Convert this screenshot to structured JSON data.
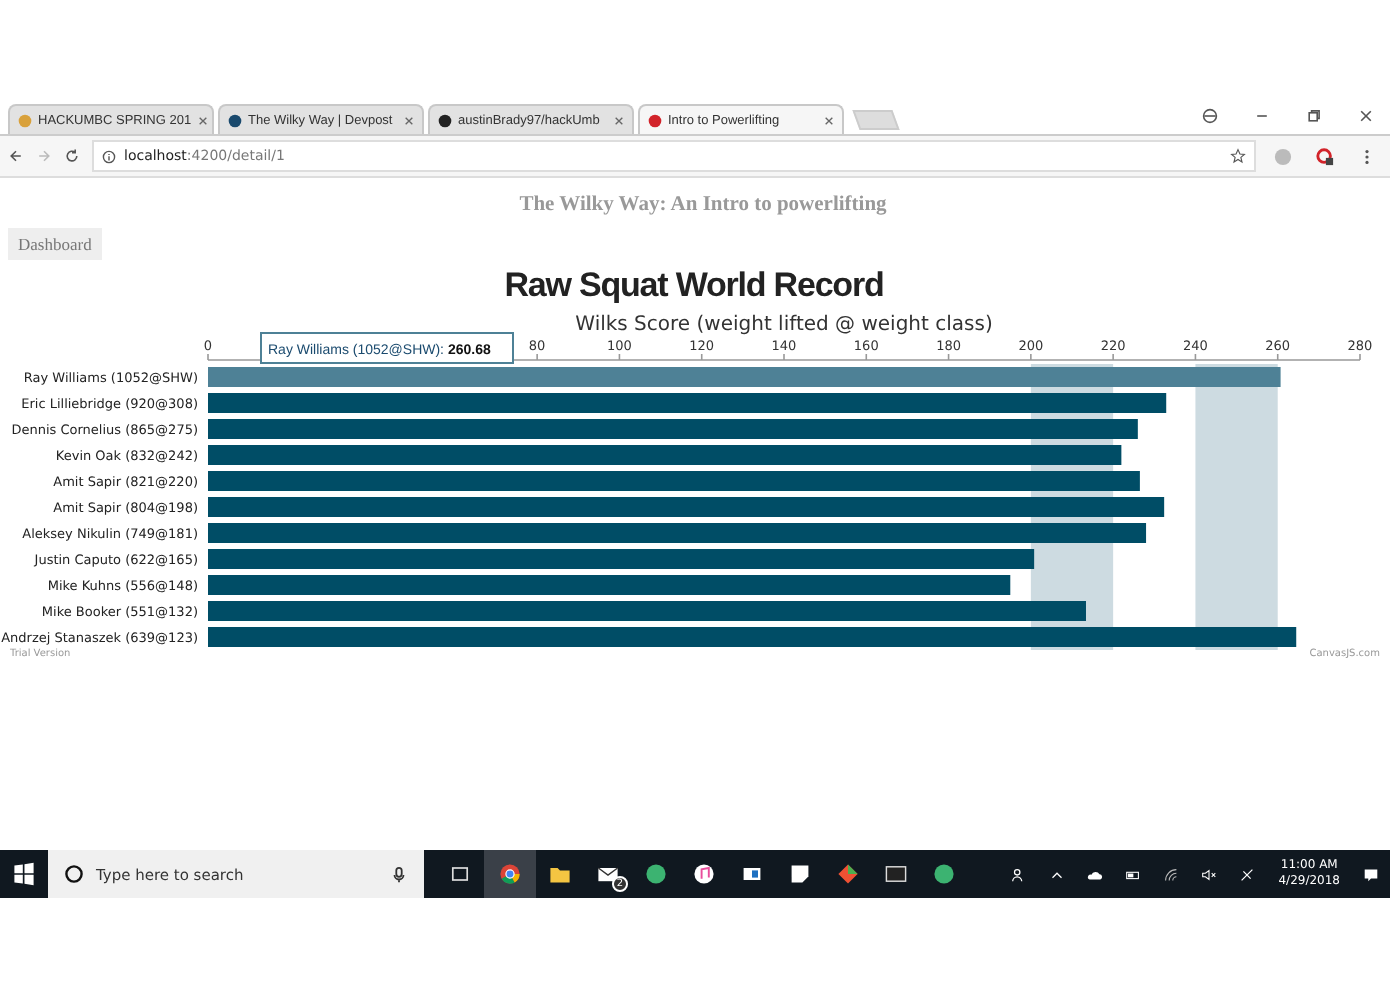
{
  "browser": {
    "tabs": [
      {
        "title": "HACKUMBC SPRING 201",
        "selected": false
      },
      {
        "title": "The Wilky Way | Devpost",
        "selected": false
      },
      {
        "title": "austinBrady97/hackUmb",
        "selected": false
      },
      {
        "title": "Intro to Powerlifting",
        "selected": true
      }
    ],
    "address": "**localhost**:4200/detail/1"
  },
  "page": {
    "heading": "The Wilky Way: An Intro to powerlifting",
    "nav_button": "Dashboard",
    "chart_data": {
      "type": "bar",
      "orientation": "horizontal",
      "stacked": true,
      "title": "Raw Squat World Record",
      "xlabel": "Wilks Score (weight lifted @ weight class)",
      "categories": [
        "Ray Williams (1052@SHW)",
        "Eric Lilliebridge (920@308)",
        "Dennis Cornelius (865@275)",
        "Kevin Oak (832@242)",
        "Amit Sapir (821@220)",
        "Amit Sapir (804@198)",
        "Aleksey Nikulin (749@181)",
        "Justin Caputo (622@165)",
        "Mike Kuhns (556@148)",
        "Mike Booker (551@132)",
        "Andrzej Stanaszek (639@123)"
      ],
      "values": [
        260.7,
        232.9,
        226,
        222,
        226.5,
        232.4,
        228,
        200.8,
        195,
        213.4,
        264.5
      ],
      "xlim": [
        0,
        280
      ],
      "xticks": [
        0,
        80,
        100,
        120,
        140,
        160,
        180,
        200,
        220,
        240,
        260,
        280
      ]
    },
    "interlaced_grid": true,
    "bar_states": [
      {
        "selected": true
      },
      {
        "selected": false
      },
      {
        "selected": false
      },
      {
        "selected": false
      },
      {
        "selected": false
      },
      {
        "selected": false
      },
      {
        "selected": false
      },
      {
        "selected": false
      },
      {
        "selected": false
      },
      {
        "selected": false
      },
      {
        "selected": false
      }
    ],
    "tooltip": {
      "label": "Ray Williams (1052@SHW):",
      "value": "260.68"
    },
    "trial_note": "Trial Version",
    "credit": "CanvasJS.com"
  },
  "taskbar": {
    "search_placeholder": "Type here to search",
    "mail_badge": "2",
    "time": "11:00 AM",
    "date": "4/29/2018"
  }
}
